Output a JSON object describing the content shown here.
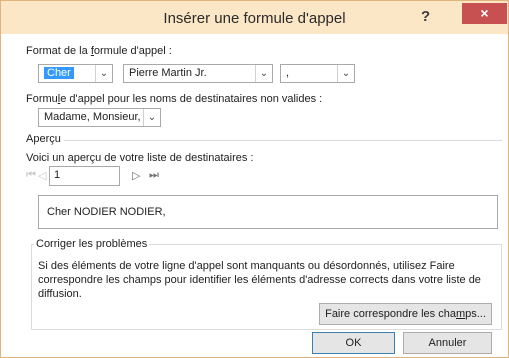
{
  "window": {
    "title": "Insérer une formule d'appel",
    "help_label": "?",
    "close_label": "×"
  },
  "salutation_format": {
    "label_before": "Format de la ",
    "label_underline": "f",
    "label_after": "ormule d'appel :",
    "greeting_value": "Cher",
    "name_format_value": "Pierre Martin Jr.",
    "punctuation_value": ","
  },
  "invalid_recipients": {
    "label_before": "Formu",
    "label_underline": "l",
    "label_after": "e d'appel pour les noms de destinataires non valides :",
    "value": "Madame, Monsieur,"
  },
  "preview_section": {
    "heading": "Aperçu",
    "description": "Voici un aperçu de votre liste de destinataires :",
    "nav_first": "⏮",
    "nav_prev": "◁",
    "record_number": "1",
    "nav_next": "▷",
    "nav_last": "⏭",
    "preview_text": "Cher NODIER NODIER,"
  },
  "fix_problems": {
    "heading": "Corriger les problèmes",
    "line1": "Si des éléments de votre ligne d'appel sont manquants ou désordonnés, utilisez Faire",
    "line2": "correspondre les champs pour identifier les éléments d'adresse corrects dans votre liste de",
    "line3": "diffusion.",
    "match_button_before": "Faire correspondre les cha",
    "match_button_underline": "m",
    "match_button_after": "ps..."
  },
  "footer": {
    "ok_label": "OK",
    "cancel_label": "Annuler"
  },
  "colors": {
    "titlebar": "#fbe7c6",
    "close_button": "#c75050",
    "selection": "#3399ff",
    "border": "#e0b47a"
  }
}
